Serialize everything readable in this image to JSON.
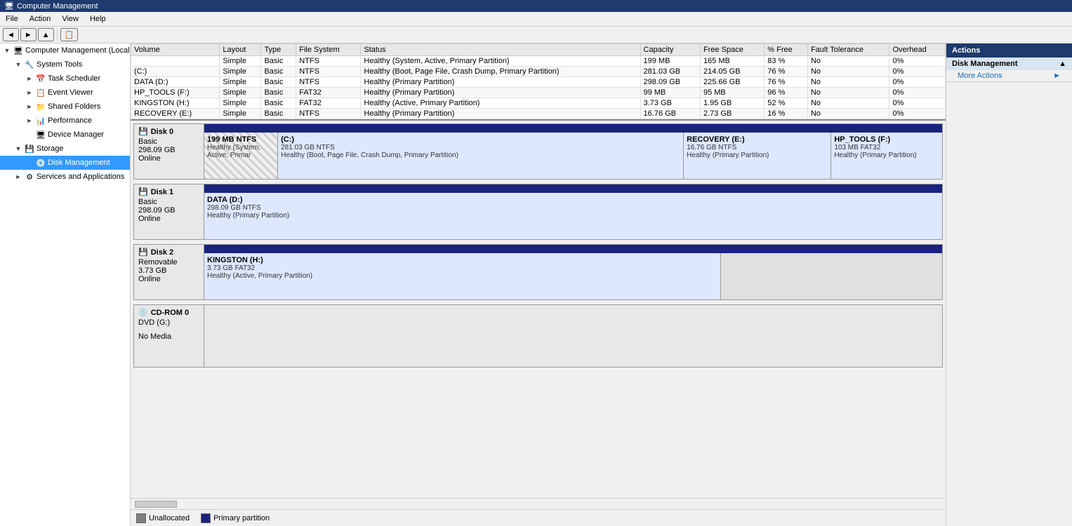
{
  "titleBar": {
    "text": "Computer Management"
  },
  "menuBar": {
    "items": [
      "File",
      "Action",
      "View",
      "Help"
    ]
  },
  "sidebar": {
    "title": "Computer Management (Local)",
    "items": [
      {
        "id": "computer-mgmt",
        "label": "Computer Management (Local)",
        "level": 0,
        "expanded": true,
        "hasExpander": false
      },
      {
        "id": "system-tools",
        "label": "System Tools",
        "level": 1,
        "expanded": true,
        "hasExpander": true
      },
      {
        "id": "task-scheduler",
        "label": "Task Scheduler",
        "level": 2,
        "expanded": false,
        "hasExpander": true
      },
      {
        "id": "event-viewer",
        "label": "Event Viewer",
        "level": 2,
        "expanded": false,
        "hasExpander": true
      },
      {
        "id": "shared-folders",
        "label": "Shared Folders",
        "level": 2,
        "expanded": false,
        "hasExpander": true
      },
      {
        "id": "performance",
        "label": "Performance",
        "level": 2,
        "expanded": false,
        "hasExpander": true
      },
      {
        "id": "device-manager",
        "label": "Device Manager",
        "level": 2,
        "expanded": false,
        "hasExpander": false
      },
      {
        "id": "storage",
        "label": "Storage",
        "level": 1,
        "expanded": true,
        "hasExpander": true
      },
      {
        "id": "disk-management",
        "label": "Disk Management",
        "level": 2,
        "expanded": false,
        "hasExpander": false,
        "selected": true
      },
      {
        "id": "services-apps",
        "label": "Services and Applications",
        "level": 1,
        "expanded": false,
        "hasExpander": true
      }
    ]
  },
  "table": {
    "columns": [
      "Volume",
      "Layout",
      "Type",
      "File System",
      "Status",
      "Capacity",
      "Free Space",
      "% Free",
      "Fault Tolerance",
      "Overhead"
    ],
    "rows": [
      {
        "volume": "",
        "layout": "Simple",
        "type": "Basic",
        "fs": "NTFS",
        "status": "Healthy (System, Active, Primary Partition)",
        "capacity": "199 MB",
        "freeSpace": "165 MB",
        "pctFree": "83 %",
        "faultTol": "No",
        "overhead": "0%"
      },
      {
        "volume": "(C:)",
        "layout": "Simple",
        "type": "Basic",
        "fs": "NTFS",
        "status": "Healthy (Boot, Page File, Crash Dump, Primary Partition)",
        "capacity": "281.03 GB",
        "freeSpace": "214.05 GB",
        "pctFree": "76 %",
        "faultTol": "No",
        "overhead": "0%"
      },
      {
        "volume": "DATA (D:)",
        "layout": "Simple",
        "type": "Basic",
        "fs": "NTFS",
        "status": "Healthy (Primary Partition)",
        "capacity": "298.09 GB",
        "freeSpace": "225.66 GB",
        "pctFree": "76 %",
        "faultTol": "No",
        "overhead": "0%"
      },
      {
        "volume": "HP_TOOLS (F:)",
        "layout": "Simple",
        "type": "Basic",
        "fs": "FAT32",
        "status": "Healthy (Primary Partition)",
        "capacity": "99 MB",
        "freeSpace": "95 MB",
        "pctFree": "96 %",
        "faultTol": "No",
        "overhead": "0%"
      },
      {
        "volume": "KINGSTON (H:)",
        "layout": "Simple",
        "type": "Basic",
        "fs": "FAT32",
        "status": "Healthy (Active, Primary Partition)",
        "capacity": "3.73 GB",
        "freeSpace": "1.95 GB",
        "pctFree": "52 %",
        "faultTol": "No",
        "overhead": "0%"
      },
      {
        "volume": "RECOVERY (E:)",
        "layout": "Simple",
        "type": "Basic",
        "fs": "NTFS",
        "status": "Healthy (Primary Partition)",
        "capacity": "16.76 GB",
        "freeSpace": "2.73 GB",
        "pctFree": "16 %",
        "faultTol": "No",
        "overhead": "0%"
      }
    ]
  },
  "disks": [
    {
      "id": "disk0",
      "label": "Disk 0",
      "sublabel": "Basic",
      "size": "298.09 GB",
      "status": "Online",
      "partitions": [
        {
          "name": "199 MB NTFS",
          "detail": "Healthy (System, Active, Primar",
          "type": "striped",
          "widthPct": 10
        },
        {
          "name": "(C:)",
          "detail1": "281.03 GB NTFS",
          "detail2": "Healthy (Boot, Page File, Crash Dump, Primary Partition)",
          "type": "primary",
          "widthPct": 55
        },
        {
          "name": "RECOVERY (E:)",
          "detail1": "16.76 GB NTFS",
          "detail2": "Healthy (Primary Partition)",
          "type": "primary",
          "widthPct": 20
        },
        {
          "name": "HP_TOOLS  (F:)",
          "detail1": "103 MB FAT32",
          "detail2": "Healthy (Primary Partition)",
          "type": "primary",
          "widthPct": 15
        }
      ]
    },
    {
      "id": "disk1",
      "label": "Disk 1",
      "sublabel": "Basic",
      "size": "298.09 GB",
      "status": "Online",
      "partitions": [
        {
          "name": "DATA (D:)",
          "detail1": "298.09 GB NTFS",
          "detail2": "Healthy (Primary Partition)",
          "type": "primary",
          "widthPct": 100
        }
      ]
    },
    {
      "id": "disk2",
      "label": "Disk 2",
      "sublabel": "Removable",
      "size": "3.73 GB",
      "status": "Online",
      "partitions": [
        {
          "name": "KINGSTON  (H:)",
          "detail1": "3.73 GB FAT32",
          "detail2": "Healthy (Active, Primary Partition)",
          "type": "primary",
          "widthPct": 70
        }
      ]
    },
    {
      "id": "cdrom0",
      "label": "CD-ROM 0",
      "sublabel": "DVD (G:)",
      "size": "",
      "status": "No Media",
      "isCdrom": true
    }
  ],
  "actions": {
    "title": "Actions",
    "sections": [
      {
        "title": "Disk Management",
        "items": [
          "More Actions"
        ],
        "hasArrow": true
      }
    ]
  },
  "statusBar": {
    "legend": [
      {
        "id": "unallocated",
        "label": "Unallocated",
        "color": "#808080"
      },
      {
        "id": "primary",
        "label": "Primary partition",
        "color": "#1a237e"
      }
    ]
  }
}
